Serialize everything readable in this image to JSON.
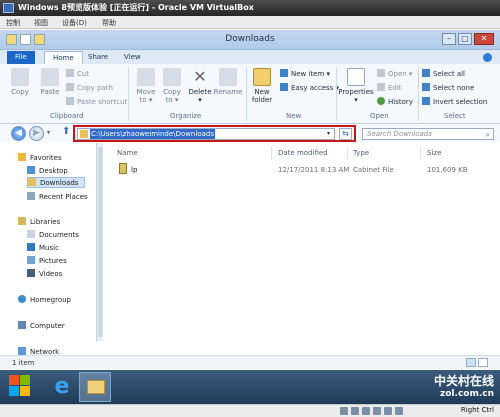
{
  "vbox": {
    "title": "Windows 8预览版体验 [正在运行] - Oracle VM VirtualBox",
    "menu": [
      "控制",
      "视图",
      "设备(D)",
      "帮助"
    ],
    "host_key": "Right Ctrl"
  },
  "window": {
    "title": "Downloads",
    "minimize": "–",
    "maximize": "□",
    "close": "✕"
  },
  "ribbon": {
    "tabs": [
      "File",
      "Home",
      "Share",
      "View"
    ],
    "clipboard": {
      "label": "Clipboard",
      "copy": "Copy",
      "paste": "Paste",
      "cut": "Cut",
      "copy_path": "Copy path",
      "paste_shortcut": "Paste shortcut"
    },
    "organize": {
      "label": "Organize",
      "move_to": "Move",
      "move_to2": "to ▾",
      "copy_to": "Copy",
      "copy_to2": "to ▾",
      "delete": "Delete",
      "delete_arrow": "▾",
      "rename": "Rename"
    },
    "new": {
      "label": "New",
      "new_folder": "New",
      "new_folder2": "folder",
      "new_item": "New item ▾",
      "easy_access": "Easy access ▾"
    },
    "open": {
      "label": "Open",
      "properties": "Properties",
      "properties_arrow": "▾",
      "open": "Open ▾",
      "edit": "Edit",
      "history": "History"
    },
    "select": {
      "label": "Select",
      "select_all": "Select all",
      "select_none": "Select none",
      "invert": "Invert selection"
    }
  },
  "address": {
    "path": "C:\\Users\\zhaoweiminde\\Downloads",
    "search_placeholder": "Search Downloads"
  },
  "nav": {
    "favorites": "Favorites",
    "desktop": "Desktop",
    "downloads": "Downloads",
    "recent": "Recent Places",
    "libraries": "Libraries",
    "documents": "Documents",
    "music": "Music",
    "pictures": "Pictures",
    "videos": "Videos",
    "homegroup": "Homegroup",
    "computer": "Computer",
    "network": "Network"
  },
  "files": {
    "columns": [
      "Name",
      "Date modified",
      "Type",
      "Size"
    ],
    "rows": [
      {
        "name": "lp",
        "date": "12/17/2011 8:13 AM",
        "type": "Cabinet File",
        "size": "101,609 KB"
      }
    ]
  },
  "status": {
    "count": "1 item"
  },
  "brand": {
    "line1": "中关村在线",
    "line2": "zol.com.cn"
  },
  "colors": {
    "accent": "#1b65c4",
    "highlight": "#c4171b",
    "selection": "#3168c9"
  }
}
